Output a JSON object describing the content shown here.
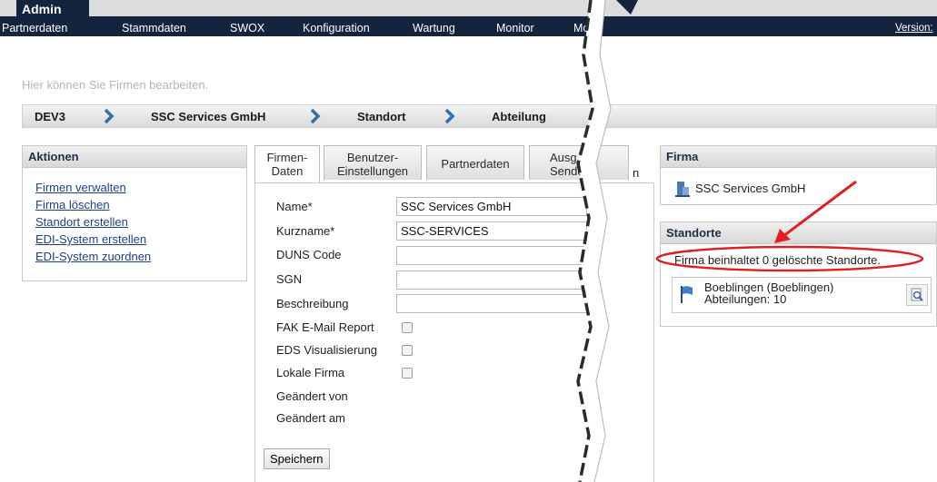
{
  "header": {
    "app_title": "Admin",
    "version_label": "Version:",
    "menu": [
      "Partnerdaten",
      "Stammdaten",
      "SWOX",
      "Konfiguration",
      "Wartung",
      "Monitor",
      "Mo"
    ]
  },
  "hint": "Hier können Sie Firmen bearbeiten.",
  "breadcrumb": [
    "DEV3",
    "SSC Services GmbH",
    "Standort",
    "Abteilung"
  ],
  "actions": {
    "title": "Aktionen",
    "links": [
      "Firmen verwalten",
      "Firma löschen",
      "Standort erstellen",
      "EDI-System erstellen",
      "EDI-System zuordnen"
    ]
  },
  "tabs": [
    {
      "line1": "Firmen-",
      "line2": "Daten",
      "active": true
    },
    {
      "line1": "Benutzer-",
      "line2": "Einstellungen"
    },
    {
      "line1": "Partnerdaten",
      "line2": ""
    },
    {
      "line1": "Ausg",
      "line2": "Sendez"
    },
    {
      "line1": "n",
      "line2": ""
    }
  ],
  "form": {
    "name_label": "Name*",
    "name_value": "SSC Services GmbH",
    "short_label": "Kurzname*",
    "short_value": "SSC-SERVICES",
    "duns_label": "DUNS Code",
    "duns_value": "",
    "sgn_label": "SGN",
    "sgn_value": "",
    "desc_label": "Beschreibung",
    "desc_value": "",
    "fak_label": "FAK E-Mail Report",
    "eds_label": "EDS Visualisierung",
    "local_label": "Lokale Firma",
    "changed_by_label": "Geändert von",
    "changed_at_label": "Geändert am",
    "save_label": "Speichern"
  },
  "firma": {
    "title": "Firma",
    "name": "SSC Services GmbH"
  },
  "standorte": {
    "title": "Standorte",
    "deleted_info": "Firma beinhaltet 0 gelöschte Standorte.",
    "items": [
      {
        "name": "Boeblingen (Boeblingen)",
        "departments": "Abteilungen: 10"
      }
    ]
  },
  "colors": {
    "navy": "#14243f",
    "annotation_red": "#e02020",
    "link_blue": "#1f3f8c"
  }
}
